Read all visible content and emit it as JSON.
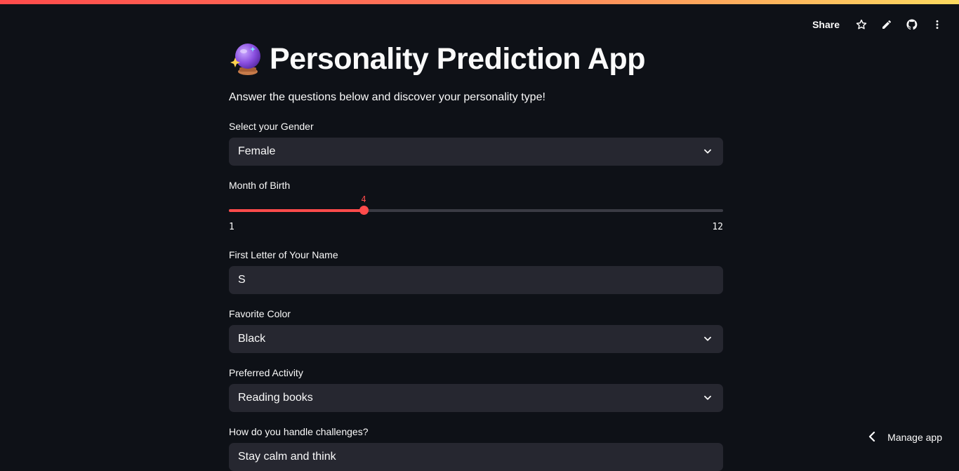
{
  "header": {
    "share_label": "Share",
    "icons": [
      "star-icon",
      "pencil-icon",
      "github-icon",
      "more-vertical-icon"
    ]
  },
  "app": {
    "title": "Personality Prediction App",
    "title_icon": "crystal-ball-icon",
    "subtitle": "Answer the questions below and discover your personality type!"
  },
  "form": {
    "gender": {
      "label": "Select your Gender",
      "value": "Female"
    },
    "month": {
      "label": "Month of Birth",
      "value": "4",
      "min": "1",
      "max": "12"
    },
    "first_letter": {
      "label": "First Letter of Your Name",
      "value": "S"
    },
    "color": {
      "label": "Favorite Color",
      "value": "Black"
    },
    "activity": {
      "label": "Preferred Activity",
      "value": "Reading books"
    },
    "challenges": {
      "label": "How do you handle challenges?",
      "value": "Stay calm and think"
    }
  },
  "footer": {
    "manage_label": "Manage app"
  },
  "colors": {
    "accent": "#ff4b4b",
    "background": "#0e1117",
    "input_bg": "#262730"
  }
}
